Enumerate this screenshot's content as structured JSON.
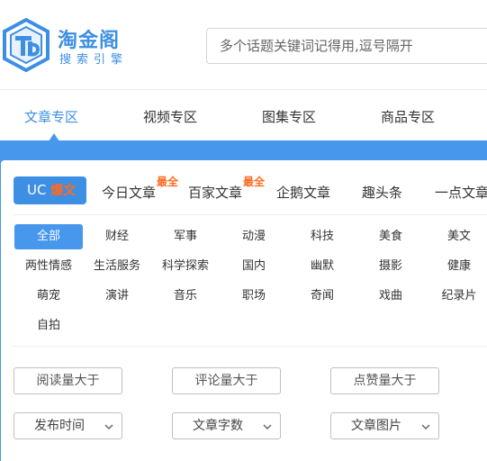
{
  "logo": {
    "title": "淘金阁",
    "subtitle": "搜索引擎",
    "icon": "tb-logo-icon"
  },
  "search": {
    "placeholder": "多个话题关键词记得用,逗号隔开"
  },
  "nav": {
    "tabs": [
      "文章专区",
      "视频专区",
      "图集专区",
      "商品专区"
    ],
    "active": 0
  },
  "sources": {
    "uc_label": "UC",
    "uc_hot": "爆文",
    "tabs": [
      "今日文章",
      "百家文章",
      "企鹅文章",
      "趣头条",
      "一点文章"
    ],
    "badges": [
      "最全",
      "最全"
    ]
  },
  "categories": [
    "全部",
    "财经",
    "军事",
    "动漫",
    "科技",
    "美食",
    "美文",
    "两性情感",
    "生活服务",
    "科学探索",
    "国内",
    "幽默",
    "摄影",
    "健康",
    "萌宠",
    "演讲",
    "音乐",
    "职场",
    "奇闻",
    "戏曲",
    "纪录片",
    "自拍"
  ],
  "active_category": "全部",
  "filters": [
    "阅读量大于",
    "评论量大于",
    "点赞量大于"
  ],
  "dropdowns": [
    "发布时间",
    "文章字数",
    "文章图片"
  ],
  "colors": {
    "accent": "#3c8fe3",
    "band": "#4797ec",
    "badge": "#ff6a1f"
  }
}
